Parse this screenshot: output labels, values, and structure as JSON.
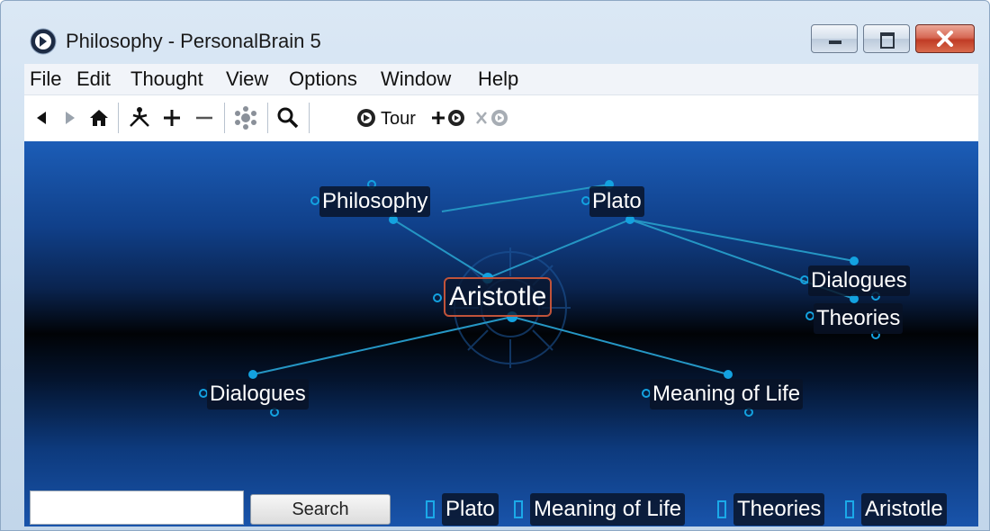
{
  "window": {
    "title": "Philosophy - PersonalBrain 5"
  },
  "menu": [
    "File",
    "Edit",
    "Thought",
    "View",
    "Options",
    "Window",
    "Help"
  ],
  "toolbar": {
    "tour_label": "Tour"
  },
  "thoughts": {
    "philosophy": "Philosophy",
    "plato": "Plato",
    "aristotle": "Aristotle",
    "dialogues_right": "Dialogues",
    "theories": "Theories",
    "dialogues_left": "Dialogues",
    "meaning_of_life": "Meaning of Life"
  },
  "search": {
    "button_label": "Search",
    "value": ""
  },
  "pins": [
    "Plato",
    "Meaning of Life",
    "Theories",
    "Aristotle"
  ],
  "colors": {
    "link": "#2596c4",
    "gate": "#13a2e0",
    "active_border": "#c0533a"
  }
}
